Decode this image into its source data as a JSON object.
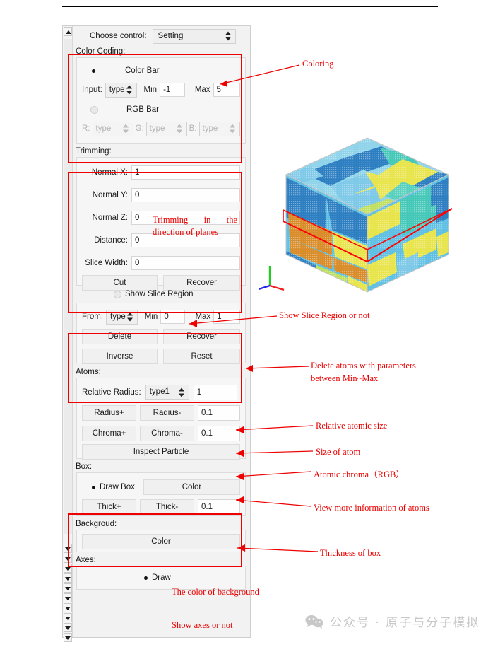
{
  "window": {
    "choose_control_label": "Choose control:",
    "choose_control_value": "Setting"
  },
  "sections": {
    "color_coding": {
      "title": "Color Coding:",
      "color_bar_label": "Color Bar",
      "input_label": "Input:",
      "input_value": "type",
      "min_label": "Min",
      "min_value": "-1",
      "max_label": "Max",
      "max_value": "5",
      "rgb_bar_label": "RGB Bar",
      "r_label": "R:",
      "r_value": "type",
      "g_label": "G:",
      "g_value": "type",
      "b_label": "B:",
      "b_value": "type"
    },
    "trimming": {
      "title": "Trimming:",
      "normal_x_label": "Normal X:",
      "normal_x_value": "1",
      "normal_y_label": "Normal Y:",
      "normal_y_value": "0",
      "normal_z_label": "Normal Z:",
      "normal_z_value": "0",
      "distance_label": "Distance:",
      "distance_value": "0",
      "slice_width_label": "Slice Width:",
      "slice_width_value": "0",
      "cut_label": "Cut",
      "recover_label": "Recover",
      "show_slice_region_label": "Show Slice Region"
    },
    "delete": {
      "from_label": "From:",
      "from_value": "type",
      "min_label": "Min",
      "min_value": "0",
      "max_label": "Max",
      "max_value": "1",
      "delete_label": "Delete",
      "recover_label": "Recover",
      "inverse_label": "Inverse",
      "reset_label": "Reset"
    },
    "atoms": {
      "title": "Atoms:",
      "relative_radius_label": "Relative Radius:",
      "relative_radius_type": "type1",
      "relative_radius_value": "1",
      "radius_plus_label": "Radius+",
      "radius_minus_label": "Radius-",
      "radius_step_value": "0.1",
      "chroma_plus_label": "Chroma+",
      "chroma_minus_label": "Chroma-",
      "chroma_step_value": "0.1",
      "inspect_particle_label": "Inspect Particle"
    },
    "box": {
      "title": "Box:",
      "draw_box_label": "Draw Box",
      "color_label": "Color",
      "thick_plus_label": "Thick+",
      "thick_minus_label": "Thick-",
      "thick_value": "0.1"
    },
    "background": {
      "title": "Backgroud:",
      "color_label": "Color"
    },
    "axes": {
      "title": "Axes:",
      "draw_label": "Draw"
    }
  },
  "annotations": {
    "coloring": "Coloring",
    "trimming": "Trimming in the direction of planes",
    "show_slice_region": "Show Slice Region or not",
    "delete_atoms_line1": "Delete atoms  with  parameters",
    "delete_atoms_line2": "between Min~Max",
    "relative_atomic_size": "Relative atomic size",
    "size_of_atom": "Size of atom",
    "atomic_chroma": "Atomic chroma（RGB）",
    "view_more_info": "View more information of atoms",
    "thickness_of_box": "Thickness of box",
    "color_of_background": "The color of background",
    "show_axes": "Show axes or not"
  },
  "watermark": {
    "text": "公众号 · 原子与分子模拟"
  },
  "colors": {
    "highlight": "#ee0000",
    "annotation": "#ee0000",
    "axis_x": "#ee2222",
    "axis_y": "#22cc22",
    "axis_z": "#2222ee",
    "slice_plane": "#ff0000"
  },
  "icons": {
    "scroll_up": "triangle-up-icon",
    "scroll_down": "triangle-down-icon",
    "combo_arrows": "updown-arrows-icon",
    "wechat": "wechat-icon"
  }
}
